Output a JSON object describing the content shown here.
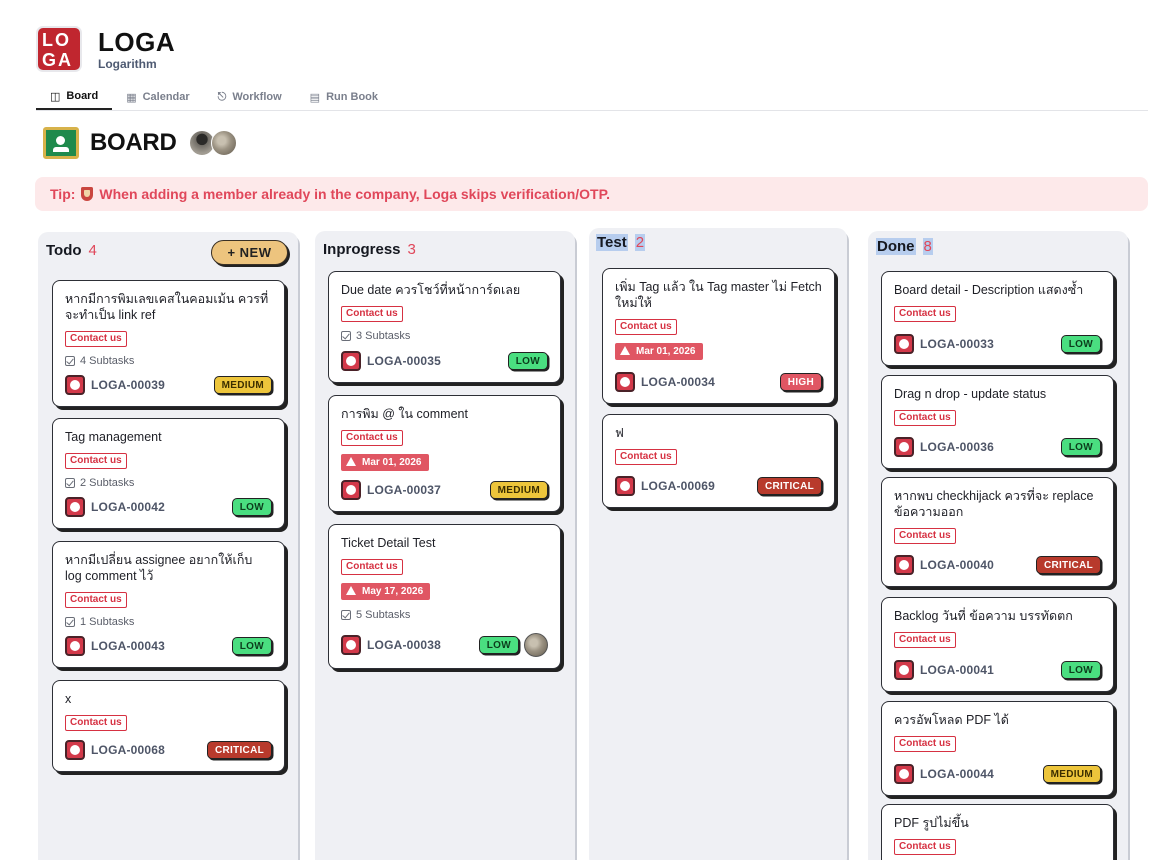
{
  "app": {
    "logo_letters": [
      "LO",
      "GA"
    ],
    "name": "LOGA",
    "subtitle": "Logarithm",
    "brand_color": "#c0262f"
  },
  "tabs": [
    {
      "label": "Board",
      "icon": "board-icon",
      "active": true
    },
    {
      "label": "Calendar",
      "icon": "calendar-icon",
      "active": false
    },
    {
      "label": "Workflow",
      "icon": "workflow-icon",
      "active": false
    },
    {
      "label": "Run Book",
      "icon": "book-icon",
      "active": false
    }
  ],
  "board": {
    "title": "BOARD",
    "icon": "classroom-board-icon",
    "members": [
      "avatar-member-1",
      "avatar-member-2"
    ]
  },
  "tip": {
    "prefix": "Tip:",
    "text": "When adding a member already in the company, Loga skips verification/OTP.",
    "icon": "shield-icon"
  },
  "columns": [
    {
      "title": "Todo",
      "count": "4",
      "new_label": "+ NEW",
      "cards": [
        {
          "title": "หากมีการพิมเลขเคสในคอมเม้น ควรที่จะทำเป็น link ref",
          "tag": "Contact us",
          "subtasks": "4 Subtasks",
          "id": "LOGA-00039",
          "priority": "MEDIUM"
        },
        {
          "title": "Tag management",
          "tag": "Contact us",
          "subtasks": "2 Subtasks",
          "id": "LOGA-00042",
          "priority": "LOW"
        },
        {
          "title": "หากมีเปลี่ยน assignee อยากให้เก็บ log comment ไว้",
          "tag": "Contact us",
          "subtasks": "1 Subtasks",
          "id": "LOGA-00043",
          "priority": "LOW"
        },
        {
          "title": "x",
          "tag": "Contact us",
          "id": "LOGA-00068",
          "priority": "CRITICAL"
        }
      ]
    },
    {
      "title": "Inprogress",
      "count": "3",
      "cards": [
        {
          "title": "Due date ควรโชว์ที่หน้าการ์ดเลย",
          "tag": "Contact us",
          "subtasks": "3 Subtasks",
          "id": "LOGA-00035",
          "priority": "LOW"
        },
        {
          "title": "การพิม @ ใน comment",
          "tag": "Contact us",
          "due": "Mar 01, 2026",
          "id": "LOGA-00037",
          "priority": "MEDIUM"
        },
        {
          "title": "Ticket Detail Test",
          "tag": "Contact us",
          "due": "May 17, 2026",
          "subtasks": "5 Subtasks",
          "id": "LOGA-00038",
          "priority": "LOW",
          "assignee": "avatar-assignee"
        }
      ]
    },
    {
      "title": "Test",
      "count": "2",
      "cards": [
        {
          "title": "เพิ่ม Tag แล้ว ใน Tag master ไม่ Fetch ใหม่ให้",
          "tag": "Contact us",
          "due": "Mar 01, 2026",
          "id": "LOGA-00034",
          "priority": "HIGH"
        },
        {
          "title": "ฟ",
          "tag": "Contact us",
          "id": "LOGA-00069",
          "priority": "CRITICAL"
        }
      ]
    },
    {
      "title": "Done",
      "count": "8",
      "cards": [
        {
          "title": "Board detail - Description แสดงซ้ำ",
          "tag": "Contact us",
          "id": "LOGA-00033",
          "priority": "LOW"
        },
        {
          "title": "Drag n drop - update status",
          "tag": "Contact us",
          "id": "LOGA-00036",
          "priority": "LOW"
        },
        {
          "title": "หากพบ checkhijack ควรที่จะ replace ข้อความออก",
          "tag": "Contact us",
          "id": "LOGA-00040",
          "priority": "CRITICAL"
        },
        {
          "title": "Backlog วันที่ ข้อความ บรรทัดตก",
          "tag": "Contact us",
          "id": "LOGA-00041",
          "priority": "LOW"
        },
        {
          "title": "ควรอัพโหลด PDF ได้",
          "tag": "Contact us",
          "id": "LOGA-00044",
          "priority": "MEDIUM"
        },
        {
          "title": "PDF รูปไม่ขึ้น",
          "tag": "Contact us"
        }
      ]
    }
  ],
  "colors": {
    "low": "#4ade80",
    "medium": "#edc53b",
    "high": "#e05663",
    "critical": "#b83a2c",
    "accent": "#e0475a"
  }
}
